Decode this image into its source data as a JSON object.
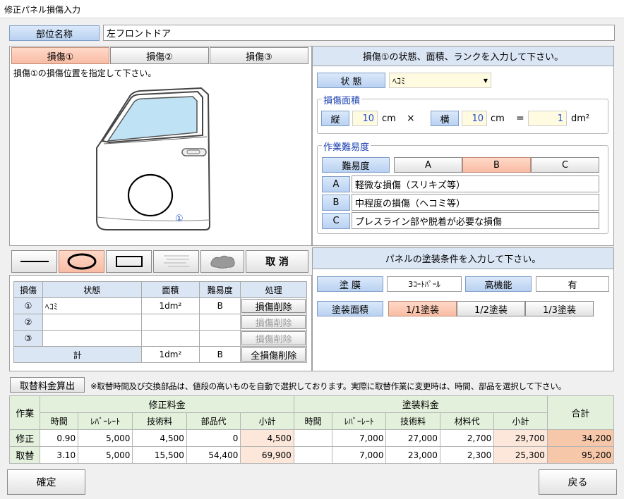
{
  "window_title": "修正パネル損傷入力",
  "part": {
    "label": "部位名称",
    "value": "左フロントドア"
  },
  "damage_tabs": [
    "損傷①",
    "損傷②",
    "損傷③"
  ],
  "damage_hint": "損傷①の損傷位置を指定して下さい。",
  "damage_marker": "①",
  "tools": {
    "cancel_label": "取 消"
  },
  "right_header": "損傷①の状態、面積、ランクを入力して下さい。",
  "state": {
    "label": "状 態",
    "value": "ﾍｺﾐ"
  },
  "area": {
    "group_title": "損傷面積",
    "vertical_label": "縦",
    "vertical_value": "10",
    "vertical_unit": "cm",
    "times": "×",
    "horizontal_label": "横",
    "horizontal_value": "10",
    "horizontal_unit": "cm",
    "equals": "=",
    "result": "1",
    "result_unit": "dm²"
  },
  "difficulty": {
    "group_title": "作業難易度",
    "label": "難易度",
    "options": [
      "A",
      "B",
      "C"
    ],
    "selected": "B",
    "descriptions": [
      {
        "key": "A",
        "text": "軽微な損傷（スリキズ等）"
      },
      {
        "key": "B",
        "text": "中程度の損傷（ヘコミ等）"
      },
      {
        "key": "C",
        "text": "プレスライン部や脱着が必要な損傷"
      }
    ]
  },
  "damage_table": {
    "headers": [
      "損傷",
      "状態",
      "面積",
      "難易度",
      "処理"
    ],
    "rows": [
      {
        "no": "①",
        "state": "ﾍｺﾐ",
        "area": "1dm²",
        "rank": "B",
        "action": "損傷削除"
      },
      {
        "no": "②",
        "state": "",
        "area": "",
        "rank": "",
        "action": "損傷削除"
      },
      {
        "no": "③",
        "state": "",
        "area": "",
        "rank": "",
        "action": "損傷削除"
      }
    ],
    "total": {
      "label": "計",
      "area": "1dm²",
      "rank": "B",
      "action": "全損傷削除"
    }
  },
  "paint": {
    "header": "パネルの塗装条件を入力して下さい。",
    "film_label": "塗 膜",
    "film_value": "3ｺｰﾄﾊﾟｰﾙ",
    "hp_label": "高機能",
    "hp_value": "有",
    "area_label": "塗装面積",
    "area_options": [
      "1/1塗装",
      "1/2塗装",
      "1/3塗装"
    ]
  },
  "calc": {
    "button": "取替料金算出",
    "note": "※取替時間及び交換部品は、値段の高いものを自動で選択しております。実際に取替作業に変更時は、時間、部品を選択して下さい。"
  },
  "fee_table": {
    "work_label": "作業",
    "repair_group": "修正料金",
    "paint_group": "塗装料金",
    "total_label": "合計",
    "columns": [
      "時間",
      "ﾚﾊﾞｰﾚｰﾄ",
      "技術料",
      "部品代",
      "小計",
      "時間",
      "ﾚﾊﾞｰﾚｰﾄ",
      "技術料",
      "材料代",
      "小計"
    ],
    "rows": [
      {
        "label": "修正",
        "values": [
          "0.90",
          "5,000",
          "4,500",
          "0",
          "4,500",
          "",
          "7,000",
          "27,000",
          "2,700",
          "29,700"
        ],
        "total": "34,200"
      },
      {
        "label": "取替",
        "values": [
          "3.10",
          "5,000",
          "15,500",
          "54,400",
          "69,900",
          "",
          "7,000",
          "23,000",
          "2,300",
          "25,300"
        ],
        "total": "95,200"
      }
    ]
  },
  "footer": {
    "confirm": "確定",
    "back": "戻る"
  }
}
